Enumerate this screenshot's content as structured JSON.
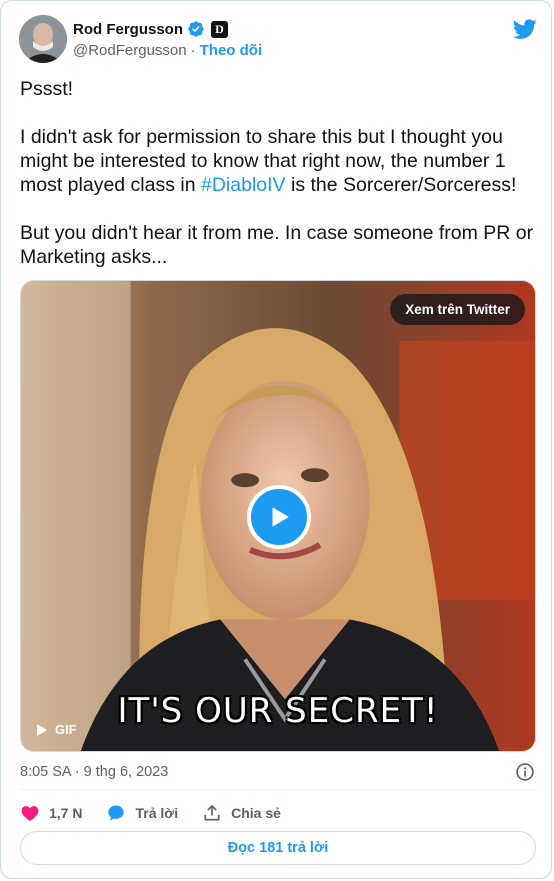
{
  "author": {
    "display_name": "Rod Fergusson",
    "handle": "@RodFergusson",
    "separator": "·",
    "follow_label": "Theo dõi",
    "affiliate_badge": "D"
  },
  "tweet": {
    "line1": "Pssst!",
    "line2_before": "I didn't ask for permission to share this but I thought you might be interested to know that right now, the number 1 most played class in ",
    "hashtag": "#DiabloIV",
    "line2_after": " is the Sorcerer/Sorceress!",
    "line3": "But you didn't hear it from me.  In case someone from PR or Marketing asks..."
  },
  "media": {
    "view_on_twitter": "Xem trên Twitter",
    "caption": "IT'S OUR SECRET!",
    "gif_label": "GIF"
  },
  "meta": {
    "timestamp": "8:05 SA · 9 thg 6, 2023"
  },
  "actions": {
    "likes": "1,7 N",
    "reply": "Trả lời",
    "share": "Chia sẻ"
  },
  "footer": {
    "read_replies": "Đọc 181 trả lời"
  },
  "colors": {
    "accent": "#1d9bf0",
    "like": "#f91880",
    "text": "#0f1419",
    "muted": "#536471"
  }
}
